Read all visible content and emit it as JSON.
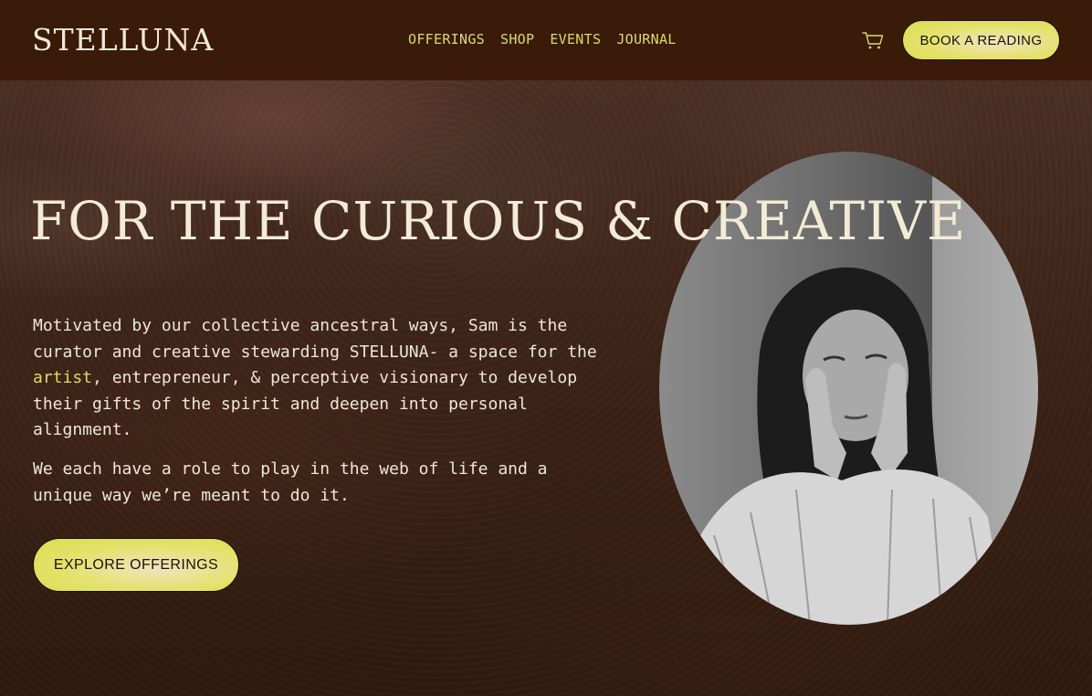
{
  "brand": {
    "logo_text": "STELLUNA"
  },
  "nav": {
    "links": [
      "OFFERINGS",
      "SHOP",
      "EVENTS",
      "JOURNAL"
    ],
    "book_label": "BOOK A READING"
  },
  "hero": {
    "headline": "FOR THE CURIOUS & CREATIVE",
    "paragraph1_before": "Motivated by our collective ancestral ways, Sam is the curator and creative stewarding STELLUNA- a space for the ",
    "paragraph1_highlight": "artist",
    "paragraph1_after": ", entrepreneur, & perceptive visionary to develop their gifts of the spirit and deepen into personal alignment.",
    "paragraph2": "We each have a role to play in the web of life and a unique way we’re meant to do it.",
    "cta_label": "EXPLORE OFFERINGS",
    "photo_icon": "portrait-photo"
  },
  "colors": {
    "nav_bg": "#3a1a08",
    "accent": "#dcdc62",
    "text": "#f3ebd6"
  }
}
